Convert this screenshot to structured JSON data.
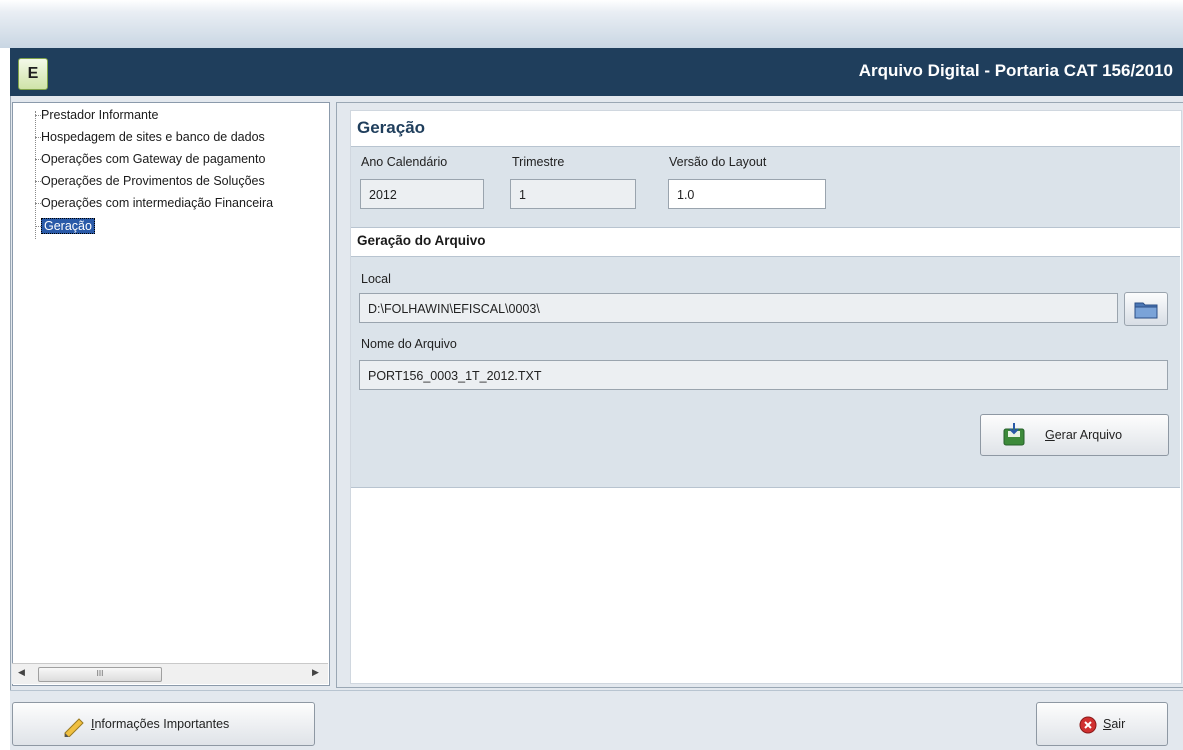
{
  "window": {
    "title": "Arquivo Digital - Portaria CAT 156/2010",
    "logo_letter": "E"
  },
  "tree": {
    "items": [
      {
        "label": "Prestador Informante"
      },
      {
        "label": "Hospedagem de sites e banco de dados"
      },
      {
        "label": "Operações com Gateway de pagamento"
      },
      {
        "label": "Operações de Provimentos de Soluções"
      },
      {
        "label": "Operações com intermediação Financeira"
      },
      {
        "label": "Geração"
      }
    ],
    "selected_index": 5,
    "scroll_grip": "III"
  },
  "main": {
    "section_title": "Geração",
    "ano_calendario": {
      "label": "Ano Calendário",
      "value": "2012"
    },
    "trimestre": {
      "label": "Trimestre",
      "value": "1"
    },
    "versao_layout": {
      "label": "Versão do Layout",
      "value": "1.0"
    },
    "subsection_title": "Geração do Arquivo",
    "local": {
      "label": "Local",
      "value": "D:\\FOLHAWIN\\EFISCAL\\0003\\"
    },
    "nome_arquivo": {
      "label": "Nome do Arquivo",
      "value": "PORT156_0003_1T_2012.TXT"
    },
    "gerar_button": {
      "mnemonic": "G",
      "rest": "erar Arquivo"
    }
  },
  "footer": {
    "info_button": {
      "mnemonic": "I",
      "rest": "nformações Importantes"
    },
    "exit_button": {
      "mnemonic": "S",
      "rest": "air"
    }
  },
  "colors": {
    "title_bar": "#1f3e5c",
    "selection": "#2a5aa8",
    "panel": "#dbe3ea"
  }
}
